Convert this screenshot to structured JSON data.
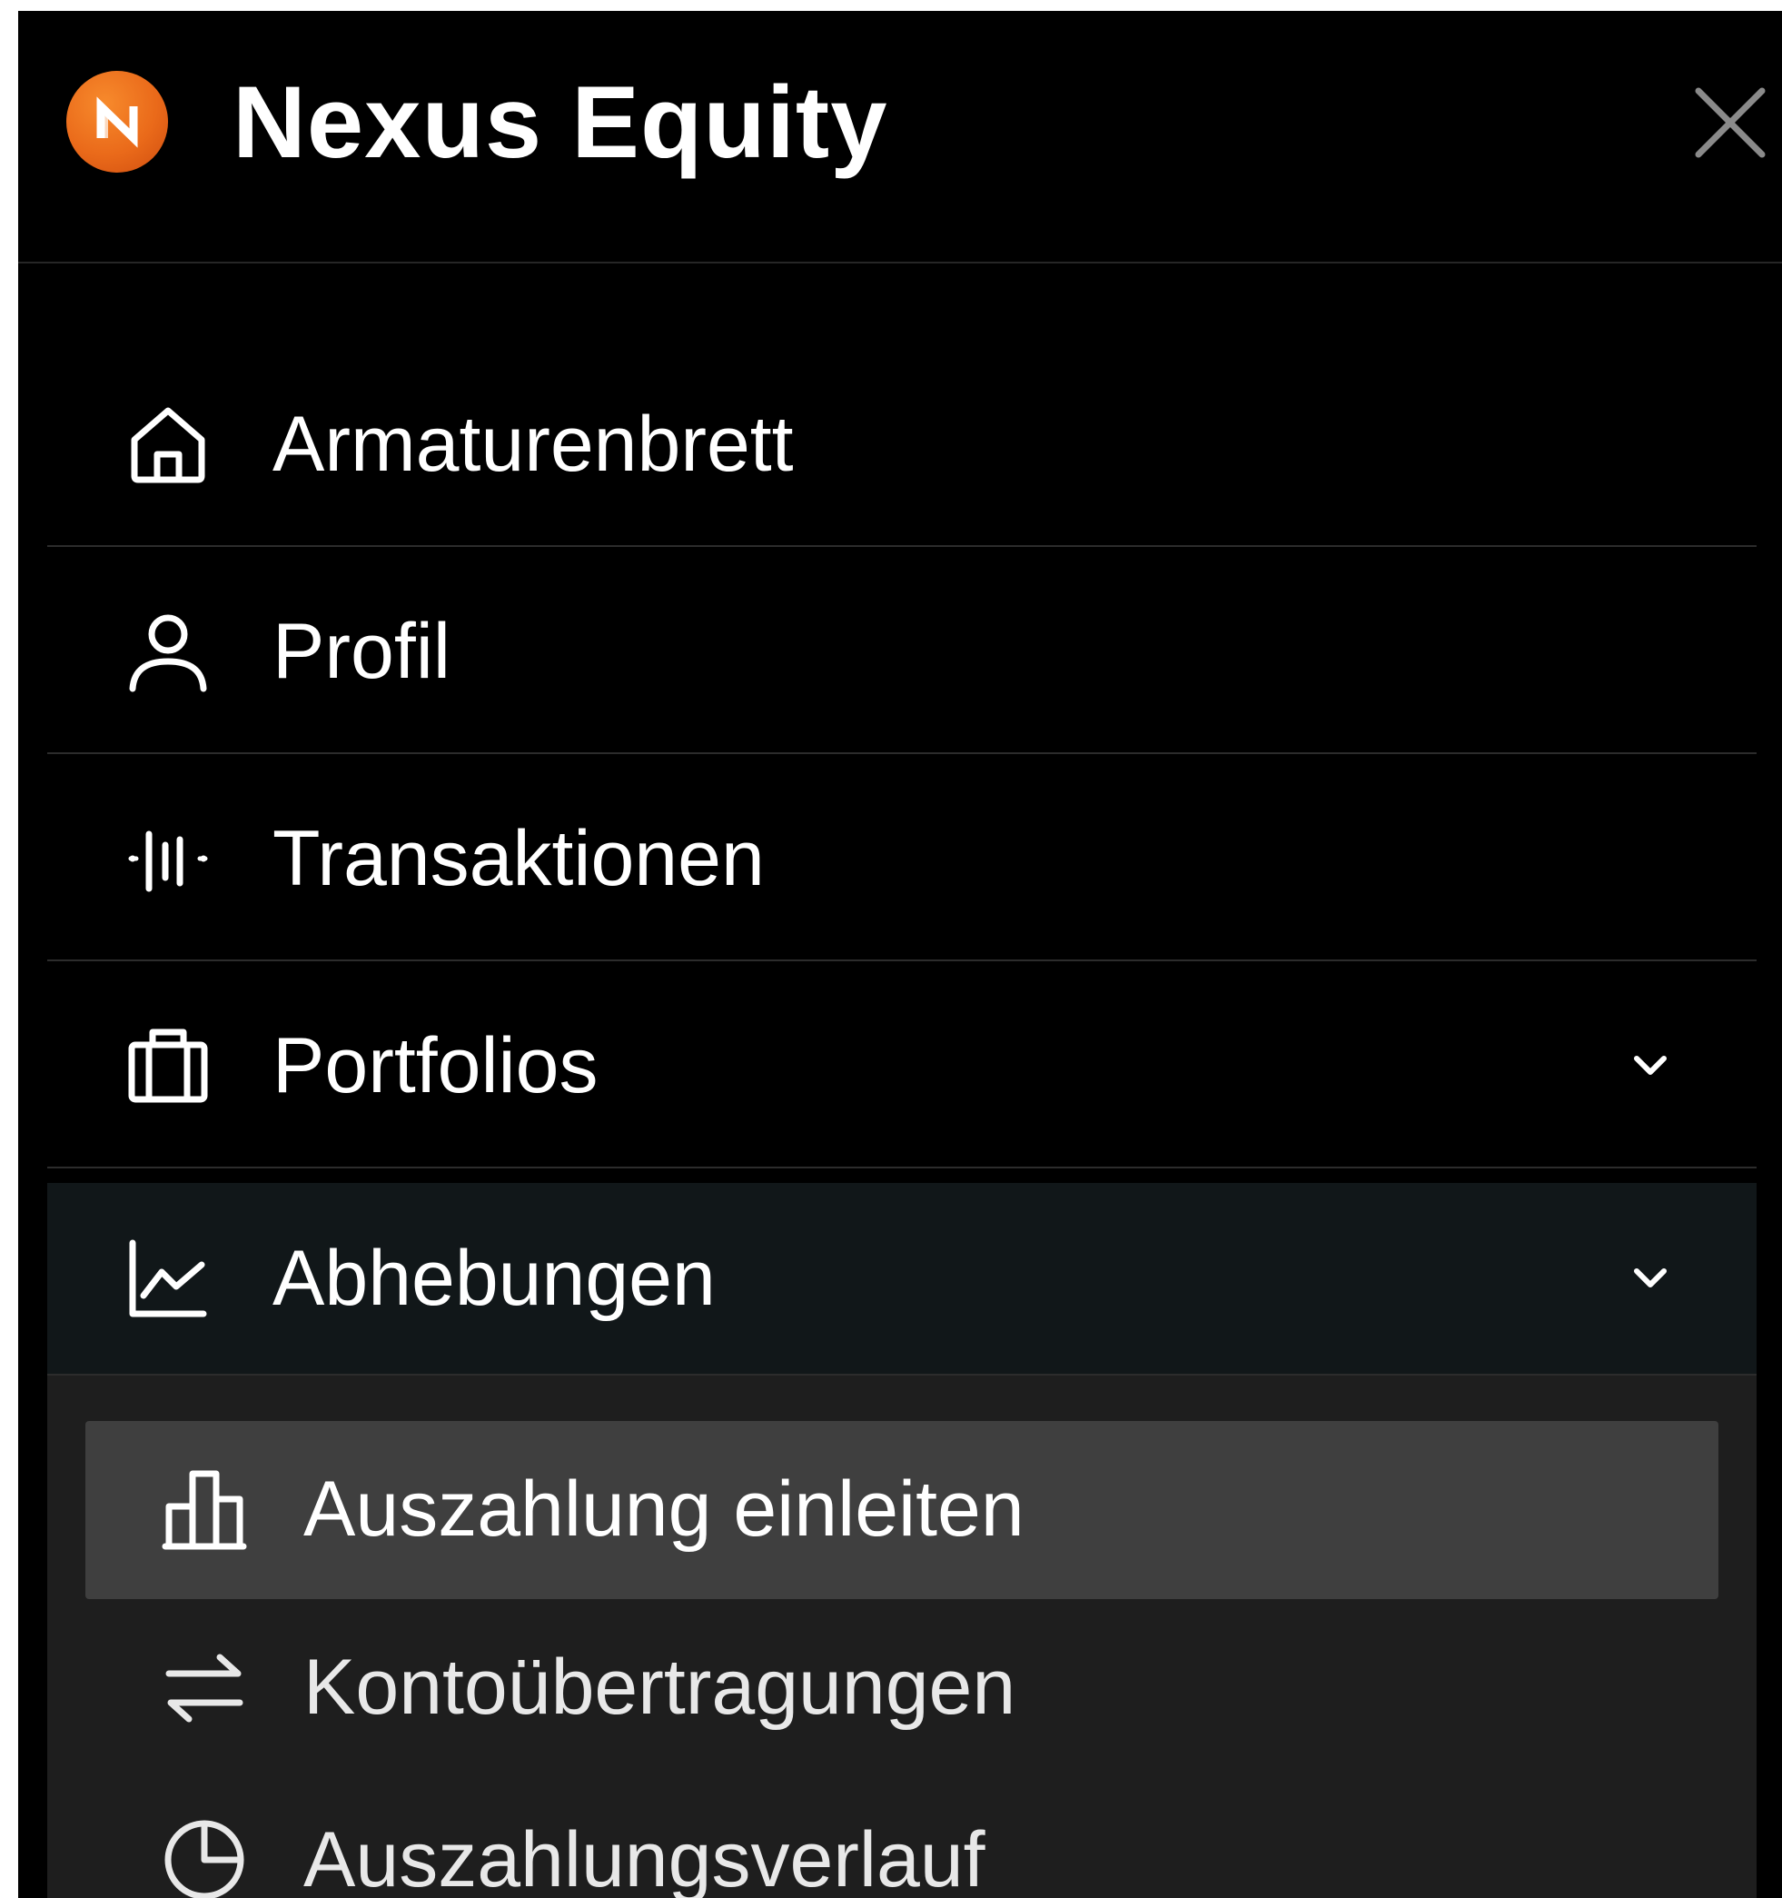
{
  "app": {
    "title": "Nexus Equity",
    "logo_letter": "N",
    "accent_color": "#ea6a1a"
  },
  "nav": {
    "items": [
      {
        "label": "Armaturenbrett",
        "icon": "home-icon"
      },
      {
        "label": "Profil",
        "icon": "user-icon"
      },
      {
        "label": "Transaktionen",
        "icon": "activity-icon"
      },
      {
        "label": "Portfolios",
        "icon": "briefcase-icon",
        "expandable": true
      },
      {
        "label": "Abhebungen",
        "icon": "line-chart-icon",
        "expandable": true,
        "expanded": true
      }
    ]
  },
  "submenu": {
    "items": [
      {
        "label": "Auszahlung einleiten",
        "icon": "bar-chart-icon",
        "active": true
      },
      {
        "label": "Kontoübertragungen",
        "icon": "transfer-arrows-icon"
      },
      {
        "label": "Auszahlungsverlauf",
        "icon": "clock-icon"
      }
    ]
  }
}
